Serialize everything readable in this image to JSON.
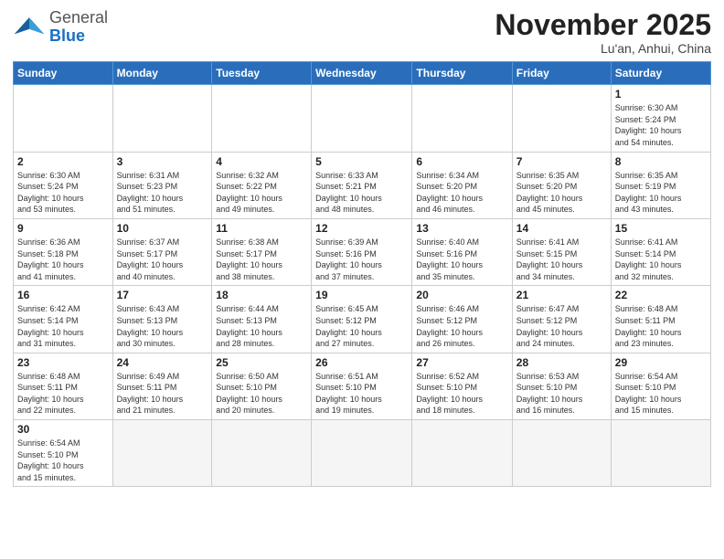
{
  "header": {
    "logo_general": "General",
    "logo_blue": "Blue",
    "month_title": "November 2025",
    "location": "Lu'an, Anhui, China"
  },
  "weekdays": [
    "Sunday",
    "Monday",
    "Tuesday",
    "Wednesday",
    "Thursday",
    "Friday",
    "Saturday"
  ],
  "weeks": [
    [
      {
        "day": "",
        "info": ""
      },
      {
        "day": "",
        "info": ""
      },
      {
        "day": "",
        "info": ""
      },
      {
        "day": "",
        "info": ""
      },
      {
        "day": "",
        "info": ""
      },
      {
        "day": "",
        "info": ""
      },
      {
        "day": "1",
        "info": "Sunrise: 6:30 AM\nSunset: 5:24 PM\nDaylight: 10 hours\nand 54 minutes."
      }
    ],
    [
      {
        "day": "2",
        "info": "Sunrise: 6:30 AM\nSunset: 5:24 PM\nDaylight: 10 hours\nand 53 minutes."
      },
      {
        "day": "3",
        "info": "Sunrise: 6:31 AM\nSunset: 5:23 PM\nDaylight: 10 hours\nand 51 minutes."
      },
      {
        "day": "4",
        "info": "Sunrise: 6:32 AM\nSunset: 5:22 PM\nDaylight: 10 hours\nand 49 minutes."
      },
      {
        "day": "5",
        "info": "Sunrise: 6:33 AM\nSunset: 5:21 PM\nDaylight: 10 hours\nand 48 minutes."
      },
      {
        "day": "6",
        "info": "Sunrise: 6:34 AM\nSunset: 5:20 PM\nDaylight: 10 hours\nand 46 minutes."
      },
      {
        "day": "7",
        "info": "Sunrise: 6:35 AM\nSunset: 5:20 PM\nDaylight: 10 hours\nand 45 minutes."
      },
      {
        "day": "8",
        "info": "Sunrise: 6:35 AM\nSunset: 5:19 PM\nDaylight: 10 hours\nand 43 minutes."
      }
    ],
    [
      {
        "day": "9",
        "info": "Sunrise: 6:36 AM\nSunset: 5:18 PM\nDaylight: 10 hours\nand 41 minutes."
      },
      {
        "day": "10",
        "info": "Sunrise: 6:37 AM\nSunset: 5:17 PM\nDaylight: 10 hours\nand 40 minutes."
      },
      {
        "day": "11",
        "info": "Sunrise: 6:38 AM\nSunset: 5:17 PM\nDaylight: 10 hours\nand 38 minutes."
      },
      {
        "day": "12",
        "info": "Sunrise: 6:39 AM\nSunset: 5:16 PM\nDaylight: 10 hours\nand 37 minutes."
      },
      {
        "day": "13",
        "info": "Sunrise: 6:40 AM\nSunset: 5:16 PM\nDaylight: 10 hours\nand 35 minutes."
      },
      {
        "day": "14",
        "info": "Sunrise: 6:41 AM\nSunset: 5:15 PM\nDaylight: 10 hours\nand 34 minutes."
      },
      {
        "day": "15",
        "info": "Sunrise: 6:41 AM\nSunset: 5:14 PM\nDaylight: 10 hours\nand 32 minutes."
      }
    ],
    [
      {
        "day": "16",
        "info": "Sunrise: 6:42 AM\nSunset: 5:14 PM\nDaylight: 10 hours\nand 31 minutes."
      },
      {
        "day": "17",
        "info": "Sunrise: 6:43 AM\nSunset: 5:13 PM\nDaylight: 10 hours\nand 30 minutes."
      },
      {
        "day": "18",
        "info": "Sunrise: 6:44 AM\nSunset: 5:13 PM\nDaylight: 10 hours\nand 28 minutes."
      },
      {
        "day": "19",
        "info": "Sunrise: 6:45 AM\nSunset: 5:12 PM\nDaylight: 10 hours\nand 27 minutes."
      },
      {
        "day": "20",
        "info": "Sunrise: 6:46 AM\nSunset: 5:12 PM\nDaylight: 10 hours\nand 26 minutes."
      },
      {
        "day": "21",
        "info": "Sunrise: 6:47 AM\nSunset: 5:12 PM\nDaylight: 10 hours\nand 24 minutes."
      },
      {
        "day": "22",
        "info": "Sunrise: 6:48 AM\nSunset: 5:11 PM\nDaylight: 10 hours\nand 23 minutes."
      }
    ],
    [
      {
        "day": "23",
        "info": "Sunrise: 6:48 AM\nSunset: 5:11 PM\nDaylight: 10 hours\nand 22 minutes."
      },
      {
        "day": "24",
        "info": "Sunrise: 6:49 AM\nSunset: 5:11 PM\nDaylight: 10 hours\nand 21 minutes."
      },
      {
        "day": "25",
        "info": "Sunrise: 6:50 AM\nSunset: 5:10 PM\nDaylight: 10 hours\nand 20 minutes."
      },
      {
        "day": "26",
        "info": "Sunrise: 6:51 AM\nSunset: 5:10 PM\nDaylight: 10 hours\nand 19 minutes."
      },
      {
        "day": "27",
        "info": "Sunrise: 6:52 AM\nSunset: 5:10 PM\nDaylight: 10 hours\nand 18 minutes."
      },
      {
        "day": "28",
        "info": "Sunrise: 6:53 AM\nSunset: 5:10 PM\nDaylight: 10 hours\nand 16 minutes."
      },
      {
        "day": "29",
        "info": "Sunrise: 6:54 AM\nSunset: 5:10 PM\nDaylight: 10 hours\nand 15 minutes."
      }
    ],
    [
      {
        "day": "30",
        "info": "Sunrise: 6:54 AM\nSunset: 5:10 PM\nDaylight: 10 hours\nand 15 minutes."
      },
      {
        "day": "",
        "info": ""
      },
      {
        "day": "",
        "info": ""
      },
      {
        "day": "",
        "info": ""
      },
      {
        "day": "",
        "info": ""
      },
      {
        "day": "",
        "info": ""
      },
      {
        "day": "",
        "info": ""
      }
    ]
  ]
}
